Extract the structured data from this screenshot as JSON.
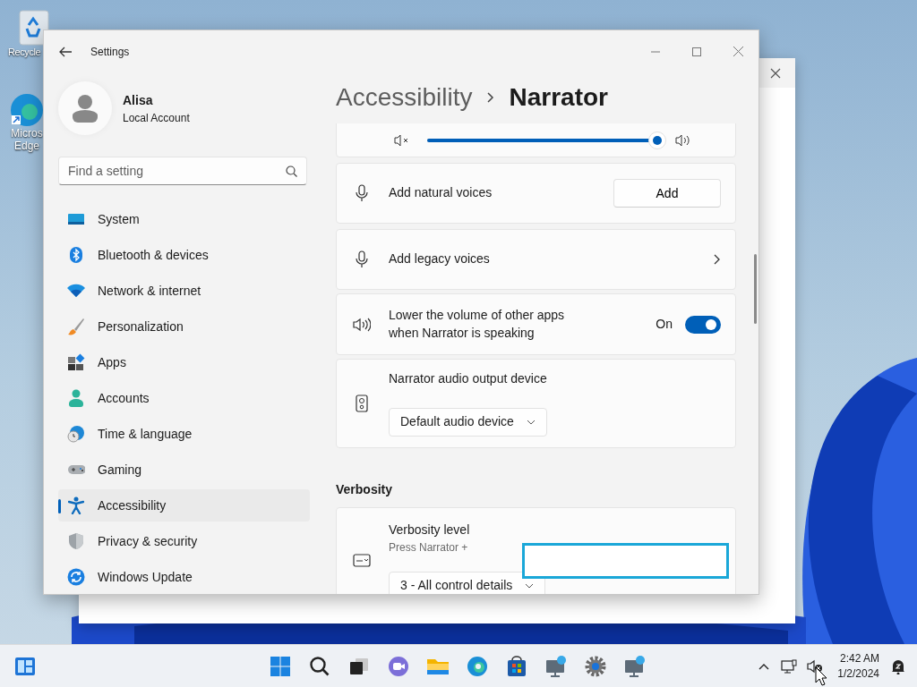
{
  "desktop": {
    "icons": [
      {
        "label": "Recycle"
      },
      {
        "label": "Micros Edge"
      }
    ]
  },
  "window": {
    "title": "Settings"
  },
  "profile": {
    "name": "Alisa",
    "account": "Local Account"
  },
  "search": {
    "placeholder": "Find a setting"
  },
  "sidebar": {
    "items": [
      {
        "label": "System",
        "selected": false
      },
      {
        "label": "Bluetooth & devices",
        "selected": false
      },
      {
        "label": "Network & internet",
        "selected": false
      },
      {
        "label": "Personalization",
        "selected": false
      },
      {
        "label": "Apps",
        "selected": false
      },
      {
        "label": "Accounts",
        "selected": false
      },
      {
        "label": "Time & language",
        "selected": false
      },
      {
        "label": "Gaming",
        "selected": false
      },
      {
        "label": "Accessibility",
        "selected": true
      },
      {
        "label": "Privacy & security",
        "selected": false
      },
      {
        "label": "Windows Update",
        "selected": false
      }
    ]
  },
  "breadcrumb": {
    "parent": "Accessibility",
    "current": "Narrator"
  },
  "volume_slider": {
    "level": 0.99
  },
  "settings": [
    {
      "kind": "button",
      "label": "Add natural voices",
      "button": "Add"
    },
    {
      "kind": "link",
      "label": "Add legacy voices"
    },
    {
      "kind": "toggle",
      "label": "Lower the volume of other apps when Narrator is speaking",
      "state_label": "On",
      "on": true
    },
    {
      "kind": "dropdown",
      "label": "Narrator audio output device",
      "value": "Default audio device"
    }
  ],
  "sections": [
    {
      "title": "Verbosity",
      "settings": [
        {
          "kind": "expander",
          "label": "Verbosity level",
          "description": "Press Narrator +",
          "value": "3 - All control details",
          "expanded": false
        }
      ]
    }
  ],
  "taskbar": {
    "time": "2:42 AM",
    "date": "1/2/2024"
  }
}
